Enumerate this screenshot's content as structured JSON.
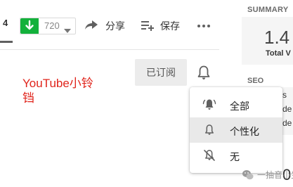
{
  "toolbar": {
    "tab_fragment": "4",
    "download": {
      "count": "720",
      "icon": "download-arrow-icon",
      "accent": "#13b13b"
    },
    "share_label": "分享",
    "save_label": "保存",
    "more_icon": "more-horizontal-icon"
  },
  "right_panel": {
    "summary_label": "SUMMARY",
    "summary_number": "1.4",
    "summary_sub": "Total V",
    "seo_label": "SEO",
    "seo_lines": [
      "s",
      "de",
      "de"
    ],
    "zero_digit": "0"
  },
  "annotation": {
    "text": "YouTube小铃铛",
    "color": "#e0241b"
  },
  "subscription": {
    "subscribed_label": "已订阅",
    "bell_icon": "bell-icon"
  },
  "notification_menu": {
    "items": [
      {
        "label": "全部",
        "icon": "bell-ringing-icon",
        "selected": false
      },
      {
        "label": "个性化",
        "icon": "bell-outline-icon",
        "selected": true
      },
      {
        "label": "无",
        "icon": "bell-off-icon",
        "selected": false
      }
    ]
  },
  "watermark": {
    "text": "一抽音小生"
  }
}
